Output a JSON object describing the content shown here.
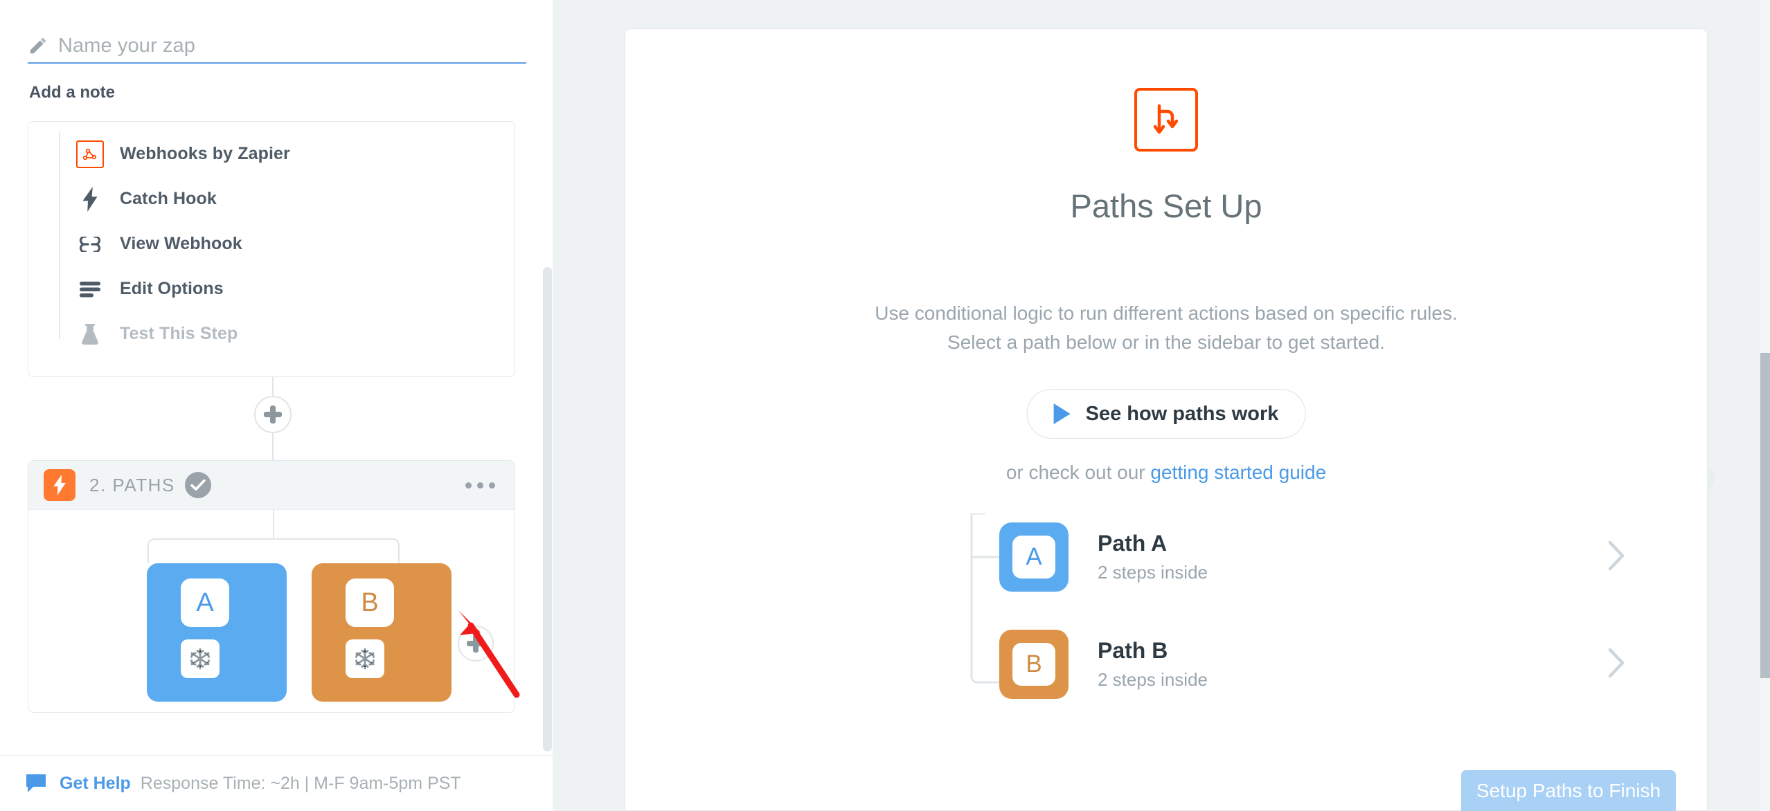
{
  "sidebar": {
    "zap_name": {
      "placeholder": "Name your zap",
      "value": "",
      "icon": "pencil-icon"
    },
    "add_note_label": "Add a note",
    "step1": {
      "rows": [
        {
          "label": "Webhooks by Zapier",
          "icon": "webhooks-app-icon",
          "muted": false
        },
        {
          "label": "Catch Hook",
          "icon": "lightning-bolt-icon",
          "muted": false
        },
        {
          "label": "View Webhook",
          "icon": "link-chain-icon",
          "muted": false
        },
        {
          "label": "Edit Options",
          "icon": "sliders-list-icon",
          "muted": false
        },
        {
          "label": "Test This Step",
          "icon": "flask-icon",
          "muted": true
        }
      ]
    },
    "add_step_button": {
      "icon": "plus-icon",
      "label": ""
    },
    "step2": {
      "title": "2. PATHS",
      "bolt_icon": "zapier-bolt-icon",
      "status_icon": "check-circle-icon",
      "menu_icon": "ellipsis-icon",
      "paths": [
        {
          "letter": "A",
          "color": "#5aabf0",
          "badge_color": "#4a9ae8",
          "step_icon": "snowflake-icon"
        },
        {
          "letter": "B",
          "color": "#dd9449",
          "badge_color": "#d08a42",
          "step_icon": "snowflake-icon"
        }
      ],
      "add_path_button": {
        "icon": "plus-icon"
      }
    },
    "annotation": {
      "type": "red-arrow",
      "points_at": "add-path-button"
    }
  },
  "footer": {
    "icon": "chat-bubble-icon",
    "get_help_label": "Get Help",
    "response_meta": "Response Time: ~2h | M-F 9am-5pm PST"
  },
  "main": {
    "hero_icon": "paths-branch-icon",
    "title": "Paths Set Up",
    "description_line1": "Use conditional logic to run different actions based on specific rules.",
    "description_line2": "Select a path below or in the sidebar to get started.",
    "see_how_button": {
      "label": "See how paths work",
      "icon": "play-icon"
    },
    "guide_prefix": "or check out our ",
    "guide_link": "getting started guide",
    "path_rows": [
      {
        "letter": "A",
        "title": "Path A",
        "subtitle": "2 steps inside",
        "chevron": "chevron-right-icon"
      },
      {
        "letter": "B",
        "title": "Path B",
        "subtitle": "2 steps inside",
        "chevron": "chevron-right-icon"
      }
    ],
    "finish_button": {
      "label": "Setup Paths to Finish",
      "enabled": false
    }
  },
  "colors": {
    "zapier_orange": "#ff4a00",
    "bolt_orange": "#ff7a30",
    "path_a_blue": "#5aabf0",
    "path_b_orange": "#dd9449",
    "link_blue": "#4a9ae8",
    "text_dark": "#2e3a43",
    "text_muted": "#9aa6ad",
    "panel_bg": "#eef2f3"
  }
}
